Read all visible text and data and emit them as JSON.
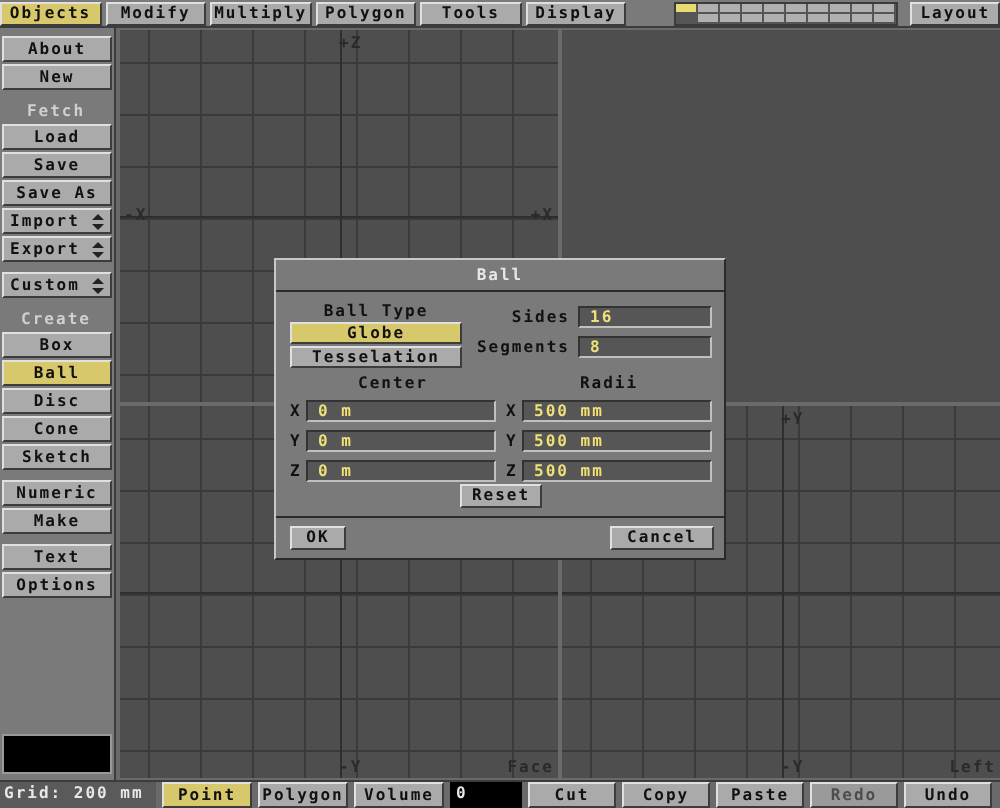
{
  "menu_tabs": [
    {
      "label": "Objects",
      "selected": true
    },
    {
      "label": "Modify",
      "selected": false
    },
    {
      "label": "Multiply",
      "selected": false
    },
    {
      "label": "Polygon",
      "selected": false
    },
    {
      "label": "Tools",
      "selected": false
    },
    {
      "label": "Display",
      "selected": false
    }
  ],
  "layers": [
    {
      "selected": true
    },
    {
      "selected": false
    },
    {
      "selected": false
    },
    {
      "selected": false
    },
    {
      "selected": false
    },
    {
      "selected": false
    },
    {
      "selected": false
    },
    {
      "selected": false
    },
    {
      "selected": false
    },
    {
      "selected": false
    }
  ],
  "layout_button": "Layout",
  "sidebar": {
    "groups": [
      [
        {
          "kind": "button",
          "label": "About",
          "selected": false
        },
        {
          "kind": "button",
          "label": "New",
          "selected": false
        }
      ],
      [
        {
          "kind": "heading",
          "label": "Fetch"
        },
        {
          "kind": "button",
          "label": "Load",
          "selected": false
        },
        {
          "kind": "button",
          "label": "Save",
          "selected": false
        },
        {
          "kind": "button",
          "label": "Save As",
          "selected": false
        },
        {
          "kind": "dropdown",
          "label": "Import"
        },
        {
          "kind": "dropdown",
          "label": "Export"
        }
      ],
      [
        {
          "kind": "dropdown",
          "label": "Custom"
        }
      ],
      [
        {
          "kind": "heading",
          "label": "Create"
        },
        {
          "kind": "button",
          "label": "Box",
          "selected": false
        },
        {
          "kind": "button",
          "label": "Ball",
          "selected": true
        },
        {
          "kind": "button",
          "label": "Disc",
          "selected": false
        },
        {
          "kind": "button",
          "label": "Cone",
          "selected": false
        },
        {
          "kind": "button",
          "label": "Sketch",
          "selected": false
        }
      ],
      [
        {
          "kind": "button",
          "label": "Numeric",
          "selected": false
        },
        {
          "kind": "button",
          "label": "Make",
          "selected": false
        }
      ],
      [
        {
          "kind": "button",
          "label": "Text",
          "selected": false
        },
        {
          "kind": "button",
          "label": "Options",
          "selected": false
        }
      ]
    ]
  },
  "viewports": [
    {
      "grid": true,
      "top_label": "+Z",
      "left_label": "-X",
      "right_label": "+X"
    },
    {
      "grid": false
    },
    {
      "grid": true,
      "bottom_label": "-Y",
      "corner_label": "Face"
    },
    {
      "grid": true,
      "top_label": "+Y",
      "bottom_label": "-Y",
      "corner_label": "Left"
    }
  ],
  "dialog": {
    "title": "Ball",
    "ball_type": {
      "label": "Ball Type",
      "options": [
        {
          "label": "Globe",
          "selected": true
        },
        {
          "label": "Tesselation",
          "selected": false
        }
      ]
    },
    "sides": {
      "label": "Sides",
      "value": "16"
    },
    "segments": {
      "label": "Segments",
      "value": "8"
    },
    "center": {
      "label": "Center",
      "rows": [
        {
          "axis": "X",
          "value": "0 m"
        },
        {
          "axis": "Y",
          "value": "0 m"
        },
        {
          "axis": "Z",
          "value": "0 m"
        }
      ]
    },
    "radii": {
      "label": "Radii",
      "rows": [
        {
          "axis": "X",
          "value": "500 mm"
        },
        {
          "axis": "Y",
          "value": "500 mm"
        },
        {
          "axis": "Z",
          "value": "500 mm"
        }
      ]
    },
    "reset": "Reset",
    "ok": "OK",
    "cancel": "Cancel"
  },
  "status_bar": [
    {
      "kind": "readout",
      "text": "Grid: 200 mm"
    },
    {
      "kind": "toggle",
      "text": "Point",
      "selected": true
    },
    {
      "kind": "toggle",
      "text": "Polygon",
      "selected": false
    },
    {
      "kind": "toggle",
      "text": "Volume",
      "selected": false
    },
    {
      "kind": "field",
      "text": "0"
    },
    {
      "kind": "button",
      "text": "Cut",
      "disabled": false
    },
    {
      "kind": "button",
      "text": "Copy",
      "disabled": false
    },
    {
      "kind": "button",
      "text": "Paste",
      "disabled": false
    },
    {
      "kind": "button",
      "text": "Redo",
      "disabled": true
    },
    {
      "kind": "button",
      "text": "Undo",
      "disabled": false
    }
  ]
}
